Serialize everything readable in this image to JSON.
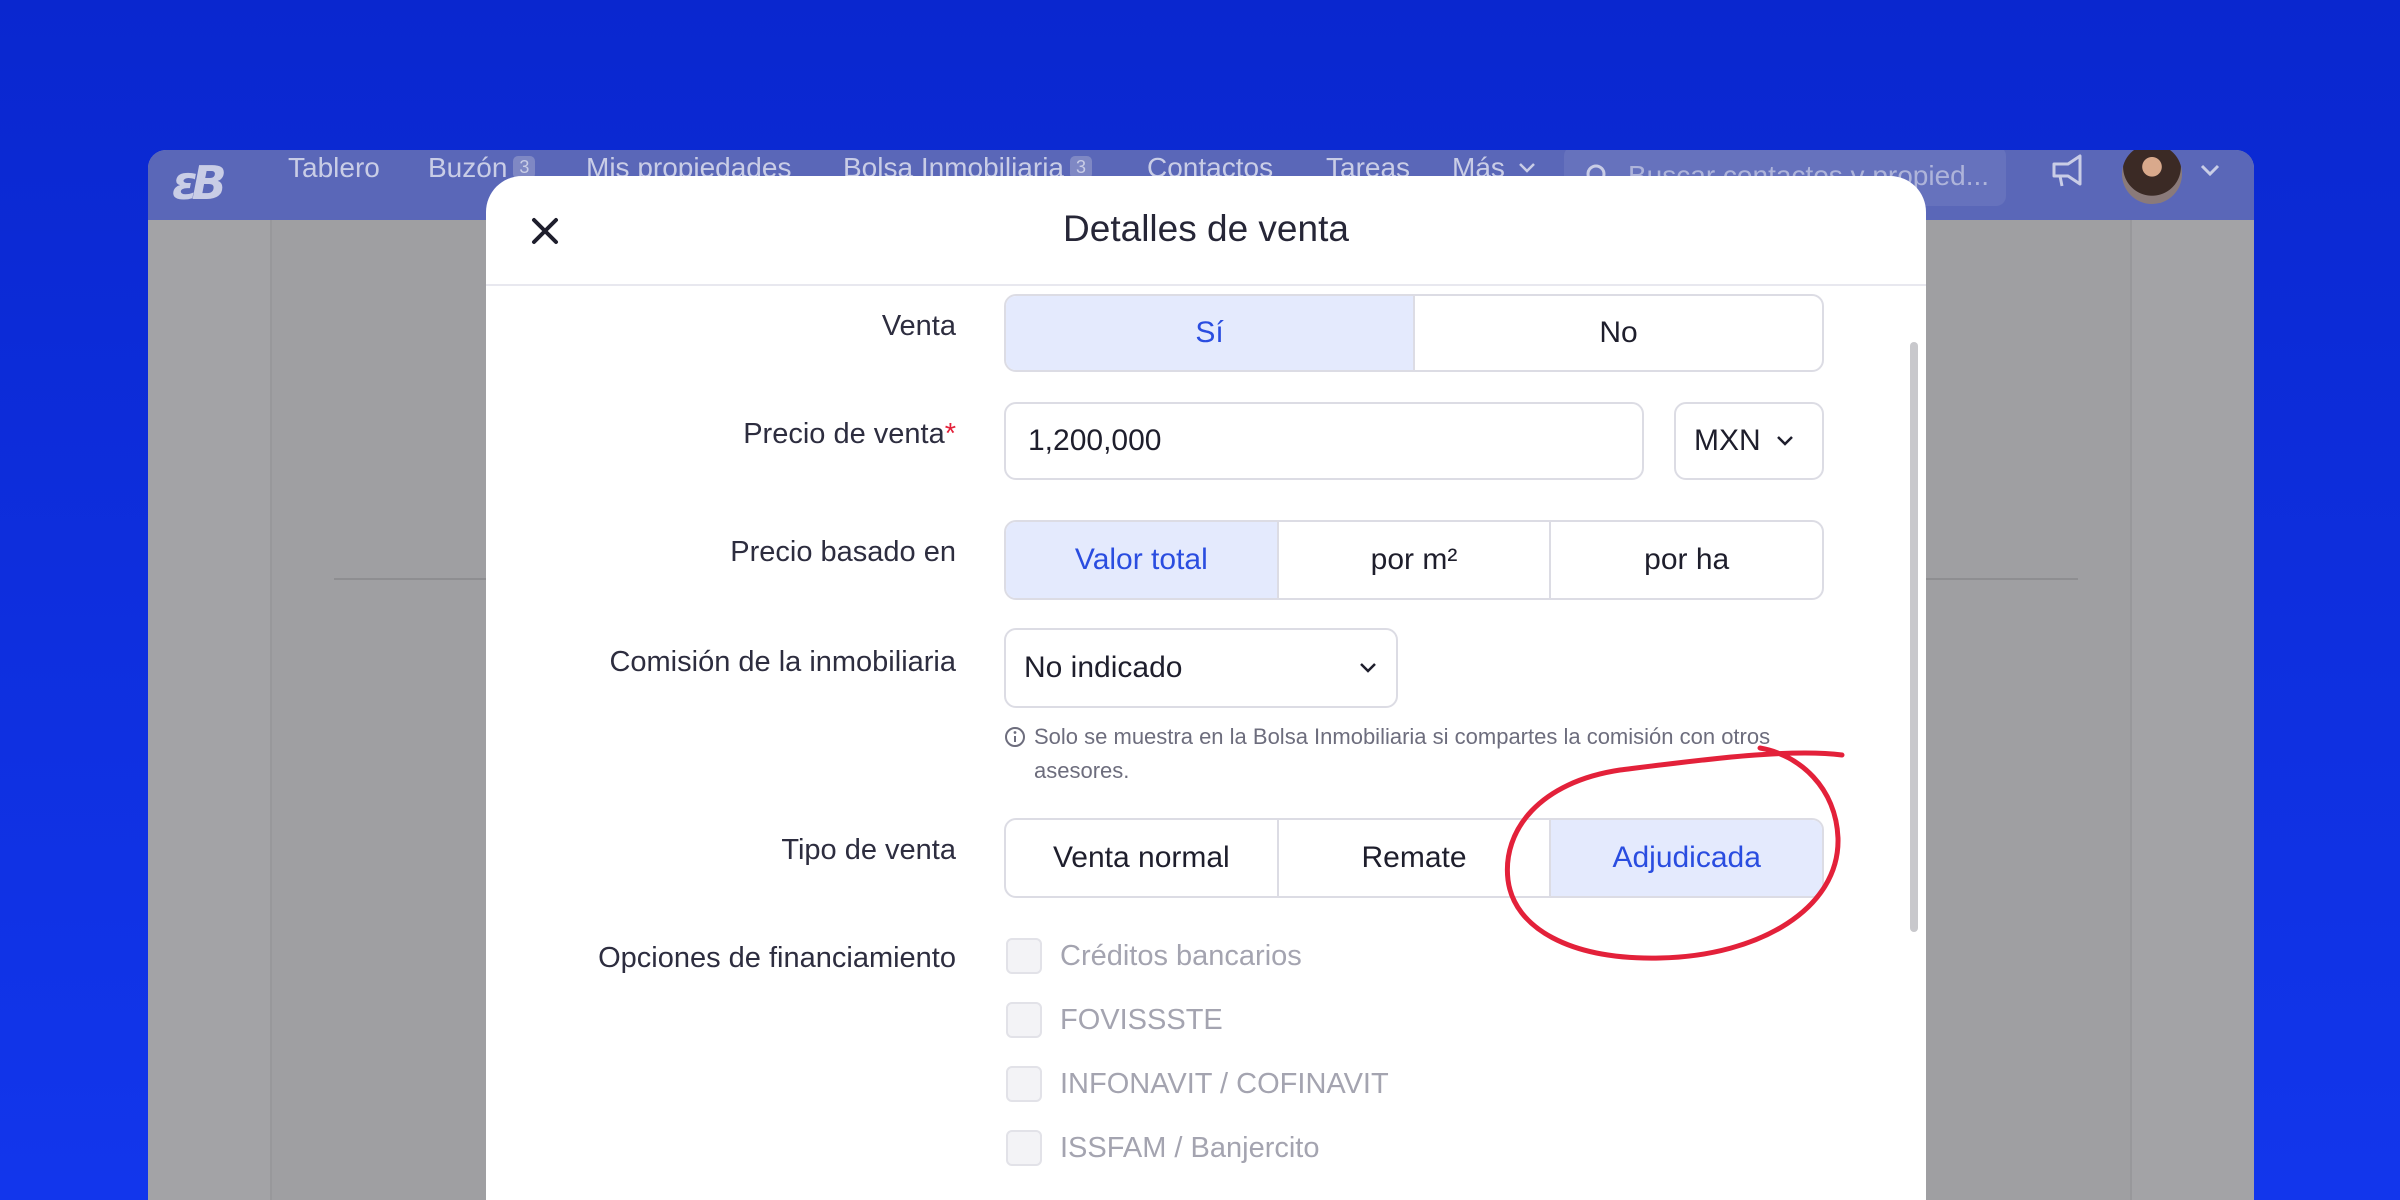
{
  "app_nav": {
    "logo": "εB",
    "items": [
      {
        "label": "Tablero"
      },
      {
        "label": "Buzón",
        "badge": "3"
      },
      {
        "label": "Mis propiedades"
      },
      {
        "label": "Bolsa Inmobiliaria",
        "badge": "3"
      },
      {
        "label": "Contactos"
      },
      {
        "label": "Tareas"
      },
      {
        "label": "Más"
      }
    ],
    "search_placeholder": "Buscar contactos y propied..."
  },
  "modal": {
    "title": "Detalles de venta",
    "venta": {
      "label": "Venta",
      "options": [
        "Sí",
        "No"
      ],
      "selected": "Sí"
    },
    "precio_venta": {
      "label": "Precio de venta",
      "required_mark": "*",
      "value": "1,200,000",
      "currency": "MXN"
    },
    "precio_basado": {
      "label": "Precio basado en",
      "options": [
        "Valor total",
        "por m²",
        "por ha"
      ],
      "selected": "Valor total"
    },
    "comision": {
      "label": "Comisión de la inmobiliaria",
      "value": "No indicado",
      "info": "Solo se muestra en la Bolsa Inmobiliaria si compartes la comisión con otros asesores."
    },
    "tipo_venta": {
      "label": "Tipo de venta",
      "options": [
        "Venta normal",
        "Remate",
        "Adjudicada"
      ],
      "selected": "Adjudicada"
    },
    "financiamiento": {
      "label": "Opciones de financiamiento",
      "options": [
        "Créditos bancarios",
        "FOVISSSTE",
        "INFONAVIT / COFINAVIT",
        "ISSFAM / Banjercito"
      ]
    }
  },
  "colors": {
    "background": "#0f2fe0",
    "accent": "#2a4de0",
    "selected_bg": "#e4eafd",
    "annotation": "#e3213a"
  }
}
